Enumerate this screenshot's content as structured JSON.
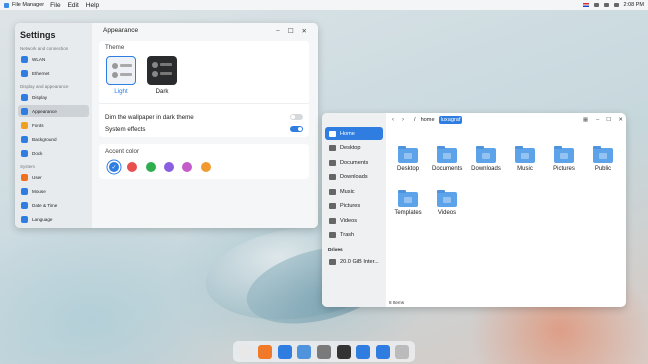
{
  "topbar": {
    "app": "File Manager",
    "menus": [
      "File",
      "Edit",
      "Help"
    ],
    "time": "2:08 PM"
  },
  "settings": {
    "title": "Settings",
    "groups": [
      {
        "label": "Network and connection",
        "items": [
          {
            "label": "WLAN",
            "icon": "wifi-icon",
            "color": "#2f7de1"
          },
          {
            "label": "Ethernet",
            "icon": "ethernet-icon",
            "color": "#2f7de1"
          }
        ]
      },
      {
        "label": "Display and appearance",
        "items": [
          {
            "label": "Display",
            "icon": "display-icon",
            "color": "#2f7de1"
          },
          {
            "label": "Appearance",
            "icon": "palette-icon",
            "color": "#2f7de1",
            "active": true
          },
          {
            "label": "Fonts",
            "icon": "fonts-icon",
            "color": "#f0a020"
          },
          {
            "label": "Background",
            "icon": "background-icon",
            "color": "#2f7de1"
          },
          {
            "label": "Dock",
            "icon": "dock-icon",
            "color": "#2f7de1"
          }
        ]
      },
      {
        "label": "System",
        "items": [
          {
            "label": "User",
            "icon": "user-icon",
            "color": "#f07020"
          },
          {
            "label": "Mouse",
            "icon": "mouse-icon",
            "color": "#2f7de1"
          },
          {
            "label": "Date & Time",
            "icon": "clock-icon",
            "color": "#2f7de1"
          },
          {
            "label": "Language",
            "icon": "language-icon",
            "color": "#2f7de1"
          }
        ]
      }
    ],
    "page_title": "Appearance",
    "theme_label": "Theme",
    "theme_light": "Light",
    "theme_dark": "Dark",
    "dim_label": "Dim the wallpaper in dark theme",
    "dim_on": false,
    "effects_label": "System effects",
    "effects_on": true,
    "accent_label": "Accent color",
    "accent_colors": [
      "#2f7de1",
      "#e85050",
      "#2fae50",
      "#8a5ee0",
      "#c45bc8",
      "#f09a30"
    ],
    "accent_selected": 0
  },
  "filemanager": {
    "breadcrumb_root": "/",
    "breadcrumb_home": "home",
    "breadcrumb_user": "luxagraf",
    "sidebar": [
      "Home",
      "Desktop",
      "Documents",
      "Downloads",
      "Music",
      "Pictures",
      "Videos",
      "Trash"
    ],
    "drives_label": "Drives",
    "drive": "20.0 GiB Inter...",
    "folders": [
      "Desktop",
      "Documents",
      "Downloads",
      "Music",
      "Pictures",
      "Public",
      "Templates",
      "Videos"
    ],
    "status": "8 Items"
  },
  "dock": [
    {
      "icon": "rocket-launcher-icon",
      "color": "#e8e8e8"
    },
    {
      "icon": "firefox-icon",
      "color": "#f07a2a"
    },
    {
      "icon": "calculator-icon",
      "color": "#2f7de1"
    },
    {
      "icon": "folder-icon",
      "color": "#4e93db"
    },
    {
      "icon": "settings-gear-icon",
      "color": "#7a7a7a"
    },
    {
      "icon": "terminal-icon",
      "color": "#333333"
    },
    {
      "icon": "app-store-icon",
      "color": "#2f7de1"
    },
    {
      "icon": "calendar-icon",
      "color": "#2f7de1"
    },
    {
      "icon": "trash-icon",
      "color": "#bbbbbb"
    }
  ]
}
